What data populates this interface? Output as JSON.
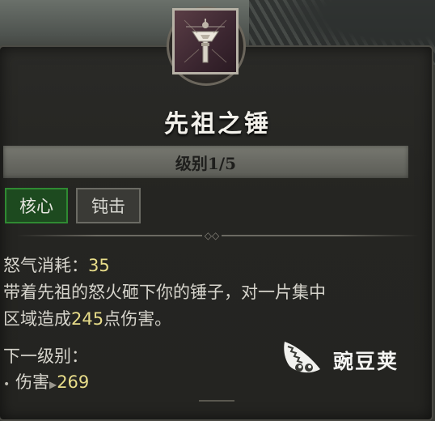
{
  "skill": {
    "name": "先祖之锤",
    "level": "级别1/5",
    "tags": [
      "核心",
      "钝击"
    ],
    "cost_label": "怒气消耗：",
    "cost_value": "35",
    "desc_line1": "带着先祖的怒火砸下你的锤子，对一片集中",
    "desc_line2_pre": "区域造成",
    "desc_damage": "245",
    "desc_line2_post": "点伤害。",
    "next_label": "下一级别：",
    "next_stat_name": "伤害",
    "next_stat_value": "269"
  },
  "watermark": {
    "text": "豌豆荚"
  },
  "colors": {
    "highlight": "#e8dd8a",
    "core_tag_bg": "#1d4a1f",
    "core_tag_border": "#2f8a32"
  },
  "icons": {
    "skill_icon": "hammer-icon",
    "watermark_logo": "pea-pod-logo"
  }
}
